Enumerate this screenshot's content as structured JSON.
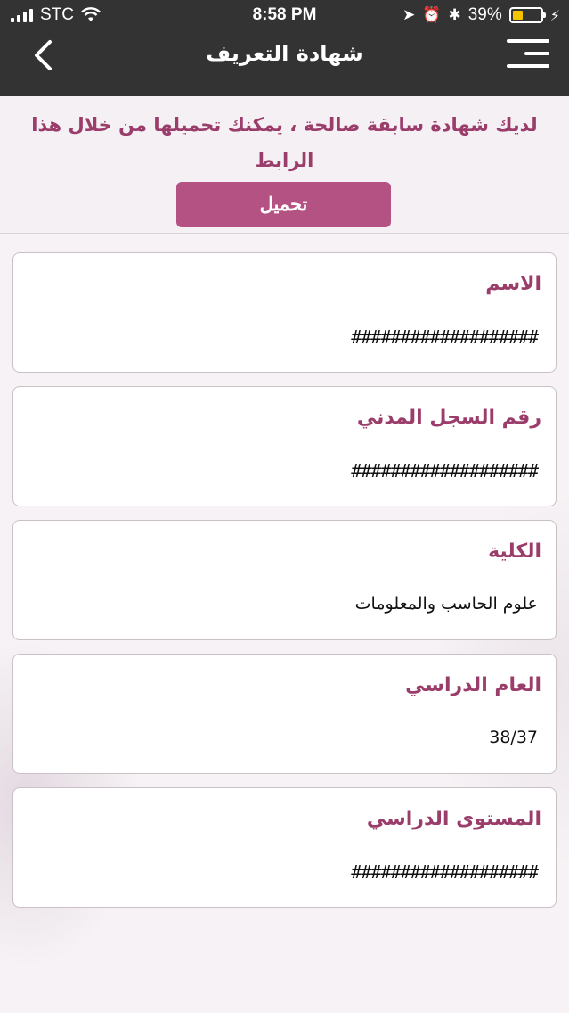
{
  "status_bar": {
    "carrier": "STC",
    "time": "8:58 PM",
    "battery_percent": "39%",
    "battery_level": 0.39
  },
  "header": {
    "title": "شهادة التعريف"
  },
  "notice": {
    "text": "لديك شهادة سابقة صالحة ، يمكنك تحميلها من خلال هذا الرابط",
    "download_label": "تحميل"
  },
  "fields": [
    {
      "label": "الاسم",
      "value": "###################"
    },
    {
      "label": "رقم السجل المدني",
      "value": "###################"
    },
    {
      "label": "الكلية",
      "value": "علوم الحاسب والمعلومات"
    },
    {
      "label": "العام الدراسي",
      "value": "38/37"
    },
    {
      "label": "المستوى الدراسي",
      "value": "###################"
    }
  ],
  "colors": {
    "accent": "#9b3d6a",
    "button": "#b45383",
    "topbar": "#333333"
  }
}
